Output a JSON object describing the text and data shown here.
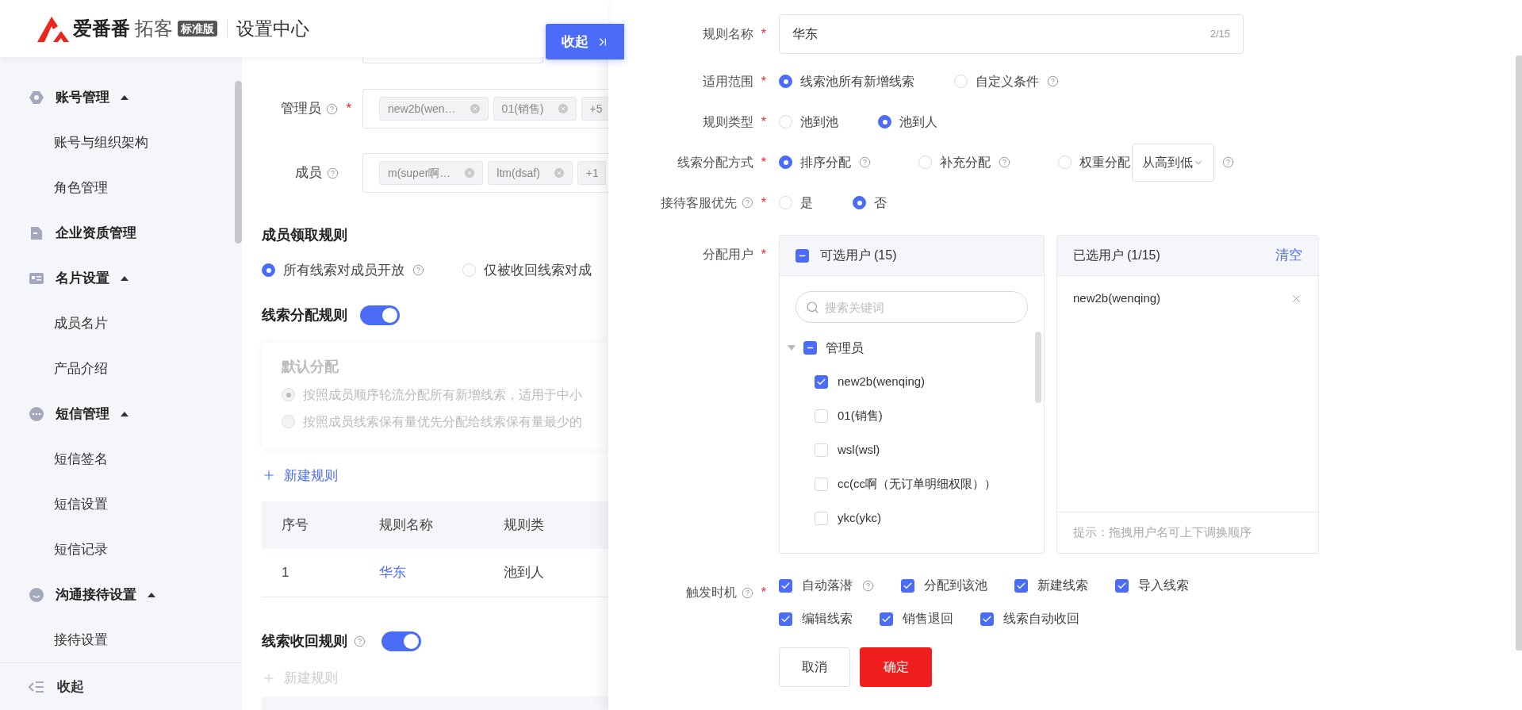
{
  "required_mark": "*",
  "header": {
    "brand": "爱番番",
    "product": "拓客",
    "edition": "标准版",
    "section": "设置中心"
  },
  "collapse_button": {
    "label": "收起"
  },
  "sidebar": {
    "items": [
      {
        "label": "账号管理",
        "kind": "account",
        "expanded": true,
        "children": [
          {
            "label": "账号与组织架构"
          },
          {
            "label": "角色管理"
          }
        ]
      },
      {
        "label": "企业资质管理",
        "kind": "document"
      },
      {
        "label": "名片设置",
        "kind": "card",
        "expanded": true,
        "children": [
          {
            "label": "成员名片"
          },
          {
            "label": "产品介绍"
          }
        ]
      },
      {
        "label": "短信管理",
        "kind": "chat",
        "expanded": true,
        "children": [
          {
            "label": "短信签名"
          },
          {
            "label": "短信设置"
          },
          {
            "label": "短信记录"
          }
        ]
      },
      {
        "label": "沟通接待设置",
        "kind": "smile",
        "expanded": true,
        "children": [
          {
            "label": "接待设置"
          }
        ]
      }
    ],
    "footer": "收起"
  },
  "pool_form": {
    "fields": [
      {
        "label": "管理员",
        "help": true,
        "required": true,
        "tags": [
          "new2b(wen…",
          "01(销售)"
        ],
        "more": "+5"
      },
      {
        "label": "成员",
        "help": true,
        "required": false,
        "tags": [
          "m(super啊…",
          "ltm(dsaf)"
        ],
        "more": "+1"
      }
    ]
  },
  "claim_rule": {
    "title": "成员领取规则",
    "options": [
      {
        "label": "所有线索对成员开放",
        "help": true,
        "selected": true
      },
      {
        "label": "仅被收回线索对成",
        "help": false,
        "selected": false
      }
    ]
  },
  "distribution_rule": {
    "title": "线索分配规则",
    "on": true,
    "default_card": {
      "title": "默认分配",
      "disabled": true,
      "options": [
        {
          "label": "按照成员顺序轮流分配所有新增线索，适用于中小",
          "selected": true
        },
        {
          "label": "按照成员线索保有量优先分配给线索保有量最少的",
          "selected": false
        }
      ]
    },
    "new_rule": {
      "label": "新建规则",
      "disabled": false
    },
    "table": {
      "columns": [
        "序号",
        "规则名称",
        "规则类"
      ],
      "rows": [
        [
          "1",
          "华东",
          "池到人"
        ]
      ]
    }
  },
  "recovery_rule": {
    "title": "线索收回规则",
    "help": true,
    "on": true,
    "new_rule": {
      "label": "新建规则",
      "disabled": true
    }
  },
  "drawer": {
    "rule_name": {
      "label": "规则名称",
      "required": true,
      "value": "华东",
      "counter": "2/15"
    },
    "radio_groups": [
      {
        "label": "适用范围",
        "required": true,
        "help": false,
        "options": [
          {
            "label": "线索池所有新增线索",
            "help": false,
            "selected": true
          },
          {
            "label": "自定义条件",
            "help": true,
            "selected": false
          }
        ]
      },
      {
        "label": "规则类型",
        "required": true,
        "help": false,
        "options": [
          {
            "label": "池到池",
            "help": false,
            "selected": false
          },
          {
            "label": "池到人",
            "help": false,
            "selected": true
          }
        ]
      },
      {
        "label": "线索分配方式",
        "required": true,
        "help": false,
        "options": [
          {
            "label": "排序分配",
            "help": true,
            "selected": true
          },
          {
            "label": "补充分配",
            "help": true,
            "selected": false
          },
          {
            "label": "权重分配",
            "help": true,
            "selected": false,
            "dropdown": "从高到低"
          }
        ]
      },
      {
        "label": "接待客服优先",
        "required": true,
        "help": true,
        "options": [
          {
            "label": "是",
            "help": false,
            "selected": false
          },
          {
            "label": "否",
            "help": false,
            "selected": true
          }
        ]
      }
    ],
    "assign_users": {
      "label": "分配用户",
      "required": true,
      "available": {
        "title": "可选用户",
        "count": "(15)",
        "checked": false,
        "indeterminate": true,
        "search_placeholder": "搜索关键词",
        "groups": [
          {
            "label": "管理员",
            "expanded": true,
            "checked": false,
            "indeterminate": true,
            "children": [
              {
                "label": "new2b(wenqing)",
                "checked": true
              },
              {
                "label": "01(销售)",
                "checked": false
              },
              {
                "label": "wsl(wsl)",
                "checked": false
              },
              {
                "label": "cc(cc啊（无订单明细权限））",
                "checked": false
              },
              {
                "label": "ykc(ykc)",
                "checked": false
              }
            ]
          }
        ]
      },
      "chosen": {
        "title": "已选用户",
        "count": "(1/15)",
        "clear": "清空",
        "items": [
          "new2b(wenqing)"
        ],
        "hint": "提示：拖拽用户名可上下调换顺序"
      }
    },
    "trigger": {
      "label": "触发时机",
      "help": true,
      "required": true,
      "options": [
        {
          "label": "自动落潜",
          "help": true,
          "checked": true
        },
        {
          "label": "分配到该池",
          "help": false,
          "checked": true
        },
        {
          "label": "新建线索",
          "help": false,
          "checked": true
        },
        {
          "label": "导入线索",
          "help": false,
          "checked": true
        },
        {
          "label": "编辑线索",
          "help": false,
          "checked": true
        },
        {
          "label": "销售退回",
          "help": false,
          "checked": true
        },
        {
          "label": "线索自动收回",
          "help": false,
          "checked": true
        }
      ]
    },
    "buttons": {
      "cancel": "取消",
      "confirm": "确定"
    }
  }
}
